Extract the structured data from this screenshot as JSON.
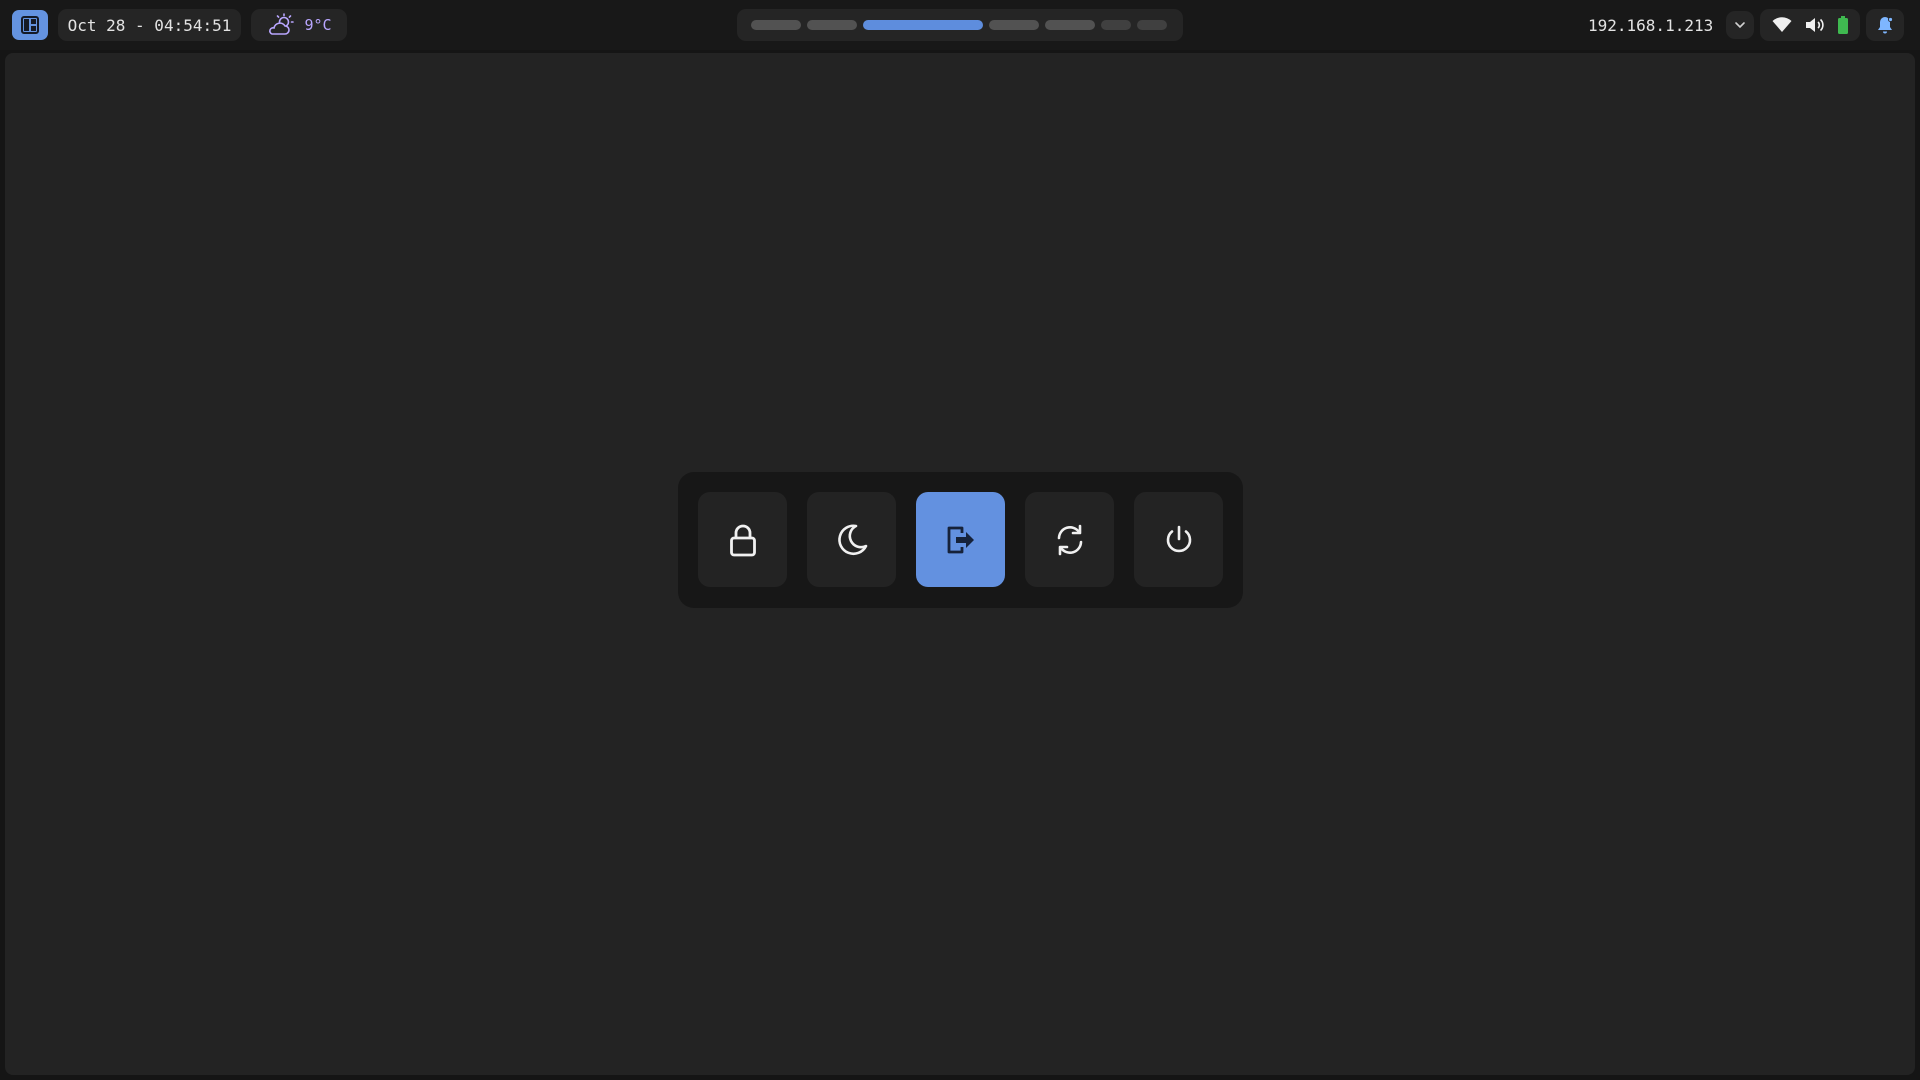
{
  "topbar": {
    "clock": "Oct 28 - 04:54:51",
    "weather": {
      "icon": "partly-cloudy-icon",
      "temperature": "9°C"
    },
    "workspaces": [
      {
        "state": "occupied"
      },
      {
        "state": "occupied"
      },
      {
        "state": "active"
      },
      {
        "state": "occupied"
      },
      {
        "state": "occupied"
      },
      {
        "state": "empty"
      },
      {
        "state": "empty"
      }
    ],
    "ip_address": "192.168.1.213",
    "status_icons": [
      "wifi-icon",
      "volume-icon",
      "battery-icon"
    ],
    "notification_icon": "bell-icon"
  },
  "session_menu": {
    "actions": [
      {
        "name": "lock",
        "icon": "lock-icon"
      },
      {
        "name": "suspend",
        "icon": "moon-icon"
      },
      {
        "name": "logout",
        "icon": "logout-icon",
        "selected": true
      },
      {
        "name": "reboot",
        "icon": "reboot-icon"
      },
      {
        "name": "shutdown",
        "icon": "power-icon"
      }
    ]
  },
  "colors": {
    "accent": "#6391e0",
    "battery": "#3fb950",
    "weather_text": "#b9a6ff",
    "notification": "#7eb6ff"
  }
}
